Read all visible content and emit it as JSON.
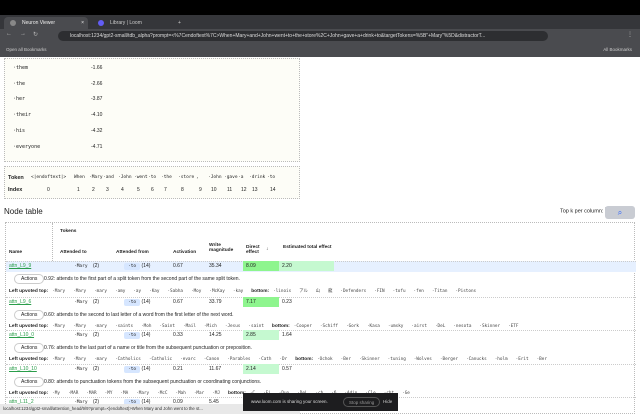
{
  "browser": {
    "tabs": [
      {
        "label": "Neuron Viewer"
      },
      {
        "label": "Library | Loom"
      }
    ],
    "url": "localhost:1234/gpt2-small/tdb_alpha?prompt=<%7Cendoftext%7C>When+Mary+and+John+went+to+the+store%2C+John+gave+a+drink+to&targetTokens=%5B\"+Mary\"%5D&distractorT...",
    "bookmarks": {
      "open": "Open all Bookmarks",
      "all": "All Bookmarks"
    }
  },
  "logits": [
    {
      "token": "·them",
      "value": "-1.66"
    },
    {
      "token": "·the",
      "value": "-2.66"
    },
    {
      "token": "·her",
      "value": "-3.87"
    },
    {
      "token": "·their",
      "value": "-4.10"
    },
    {
      "token": "·his",
      "value": "-4.32"
    },
    {
      "token": "·everyone",
      "value": "-4.71"
    }
  ],
  "tokens": {
    "token_label": "Token",
    "index_label": "Index",
    "list": [
      "<|endoftext|>",
      "When",
      "·Mary",
      "·and",
      "·John",
      "·went",
      "·to",
      "·the",
      "·store",
      ",",
      "·John",
      "·gave",
      "·a",
      "·drink",
      "·to"
    ],
    "indices": [
      "0",
      "1",
      "2",
      "3",
      "4",
      "5",
      "6",
      "7",
      "8",
      "9",
      "10",
      "11",
      "12",
      "13",
      "14"
    ]
  },
  "node_table": {
    "title": "Node table",
    "topk_label": "Top k per column:",
    "topk_value": "10",
    "headers": {
      "tokens": "Tokens",
      "name": "Name",
      "attended_to": "Attended to",
      "attended_from": "Attended from",
      "activation": "Activation",
      "write": "Write magnitude",
      "direct": "Direct effect",
      "direct_sort": "↓",
      "estimated": "Estimated total effect"
    },
    "actions_label": "Actions",
    "upvoted_label": "Left upvoted top:",
    "bottom_label": "bottom:",
    "rows": [
      {
        "name": "attn_L9_9",
        "to": "·Mary",
        "to_idx": "(2)",
        "from": "·to",
        "from_idx": "(14)",
        "activation": "0.67",
        "write": "35.34",
        "direct": "8.09",
        "estimated": "2.20",
        "desc": "0.92: attends to the first part of a split token from the second part of the same split token.",
        "top": [
          "·Mary",
          "·Mary",
          "·mary",
          "·amy",
          "·ay",
          "·Kay",
          "·Sabha",
          "·Moy",
          "·McKay",
          "·kay"
        ],
        "bottom": [
          "·linois",
          "アル",
          "山",
          "龍",
          "·Defenders",
          "·FIN",
          "·tofu",
          "·fen",
          "·Titan",
          "·Pistons"
        ]
      },
      {
        "name": "attn_L9_6",
        "to": "·Mary",
        "to_idx": "(2)",
        "from": "·to",
        "from_idx": "(14)",
        "activation": "0.67",
        "write": "33.79",
        "direct": "7.17",
        "estimated": "0.23",
        "desc": "0.60: attends to the second to last letter of a word from the first letter of the next word.",
        "top": [
          "·Mary",
          "·Mary",
          "·mary",
          "·saints",
          "·Moh",
          "·Saint",
          "·Mail",
          "·Mich",
          "·Jesus",
          "·saint"
        ],
        "bottom": [
          "·Cooper",
          "·Schiff",
          "·Gork",
          "·Kasa",
          "·umsky",
          "·airst",
          "·DeL",
          "·nesota",
          "·Skinner",
          "·ETF"
        ]
      },
      {
        "name": "attn_L10_0",
        "to": "·Mary",
        "to_idx": "(2)",
        "from": "·to",
        "from_idx": "(14)",
        "activation": "0.33",
        "write": "14.25",
        "direct": "2.85",
        "estimated": "1.64",
        "desc": "0.76: attends to the last part of a name or title from the subsequent punctuation or preposition.",
        "top": [
          "·Mary",
          "·Mary",
          "·mary",
          "·Catholics",
          "·Catholic",
          "·evarc",
          "·Canon",
          "·Parables",
          "·Cath",
          "·Dr"
        ],
        "bottom": [
          "·Ochok",
          "·Ber",
          "·Skinner",
          "·tuning",
          "·Wolves",
          "·Berger",
          "·Canucks",
          "·holm",
          "·Erit",
          "·Ber"
        ]
      },
      {
        "name": "attn_L10_10",
        "to": "·Mary",
        "to_idx": "(2)",
        "from": "·to",
        "from_idx": "(14)",
        "activation": "0.21",
        "write": "11.67",
        "direct": "2.14",
        "estimated": "0.57",
        "desc": "0.80: attends to punctuation tokens from the subsequent punctuation or coordinating conjunctions.",
        "top": [
          "·My",
          "·MAR",
          "·MAR",
          "·MY",
          "·MA",
          "·Mary",
          "·McC",
          "·Mah",
          "·Mar",
          "·MJ"
        ],
        "bottom": [
          "·C",
          "·Ei",
          "·Duo",
          "·DeL",
          "·ch",
          "·б",
          "·Adin",
          "·Cle",
          "·cht",
          "·Ge"
        ]
      },
      {
        "name": "attn_L11_2",
        "to": "·Mary",
        "to_idx": "(2)",
        "from": "·to",
        "from_idx": "(14)",
        "activation": "0.09",
        "write": "5.45",
        "direct": "",
        "estimated": ""
      }
    ]
  },
  "status_url": "localhost:1234/gpt2-small/attention_head/9/9?prompt=<|endoftext|>When Mary and John went to the st...",
  "loom": {
    "text": "www.loom.com is sharing your screen.",
    "stop": "Stop sharing",
    "hide": "Hide"
  }
}
